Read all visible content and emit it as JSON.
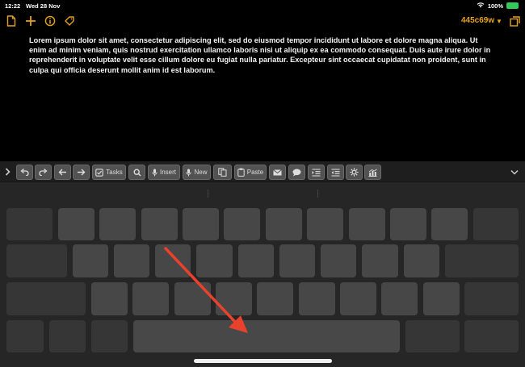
{
  "status_bar": {
    "time": "12:22",
    "date": "Wed 28 Nov",
    "battery_percent": "100%",
    "battery_color": "#34c759"
  },
  "toolbar": {
    "left_icons": [
      "document-icon",
      "plus-icon",
      "info-icon",
      "tag-icon"
    ],
    "device_name": "445c69w",
    "accent_color": "#e6a21e",
    "right_icon": "window-icon"
  },
  "document": {
    "text": "Lorem ipsum dolor sit amet, consectetur adipiscing elit, sed do eiusmod tempor incididunt ut labore et dolore magna aliqua. Ut enim ad minim veniam, quis nostrud exercitation ullamco laboris nisi ut aliquip ex ea commodo consequat. Duis aute irure dolor in reprehenderit in voluptate velit esse cillum dolore eu fugiat nulla pariatur. Excepteur sint occaecat cupidatat non proident, sunt in culpa qui officia deserunt mollit anim id est laborum."
  },
  "shortcut_bar": {
    "tasks_label": "Tasks",
    "insert_label": "Insert",
    "new_label": "New",
    "paste_label": "Paste",
    "icons": [
      "chevron-right-icon",
      "undo-icon",
      "redo-icon",
      "arrow-left-icon",
      "arrow-right-icon",
      "checkbox-icon",
      "search-icon",
      "mic-icon",
      "mic-icon",
      "copy-icon",
      "clipboard-icon",
      "mail-icon",
      "speech-bubble-icon",
      "indent-icon",
      "outdent-icon",
      "settings-icon",
      "chart-icon",
      "chevron-down-icon"
    ]
  },
  "annotation": {
    "arrow_color": "#e8412c"
  }
}
